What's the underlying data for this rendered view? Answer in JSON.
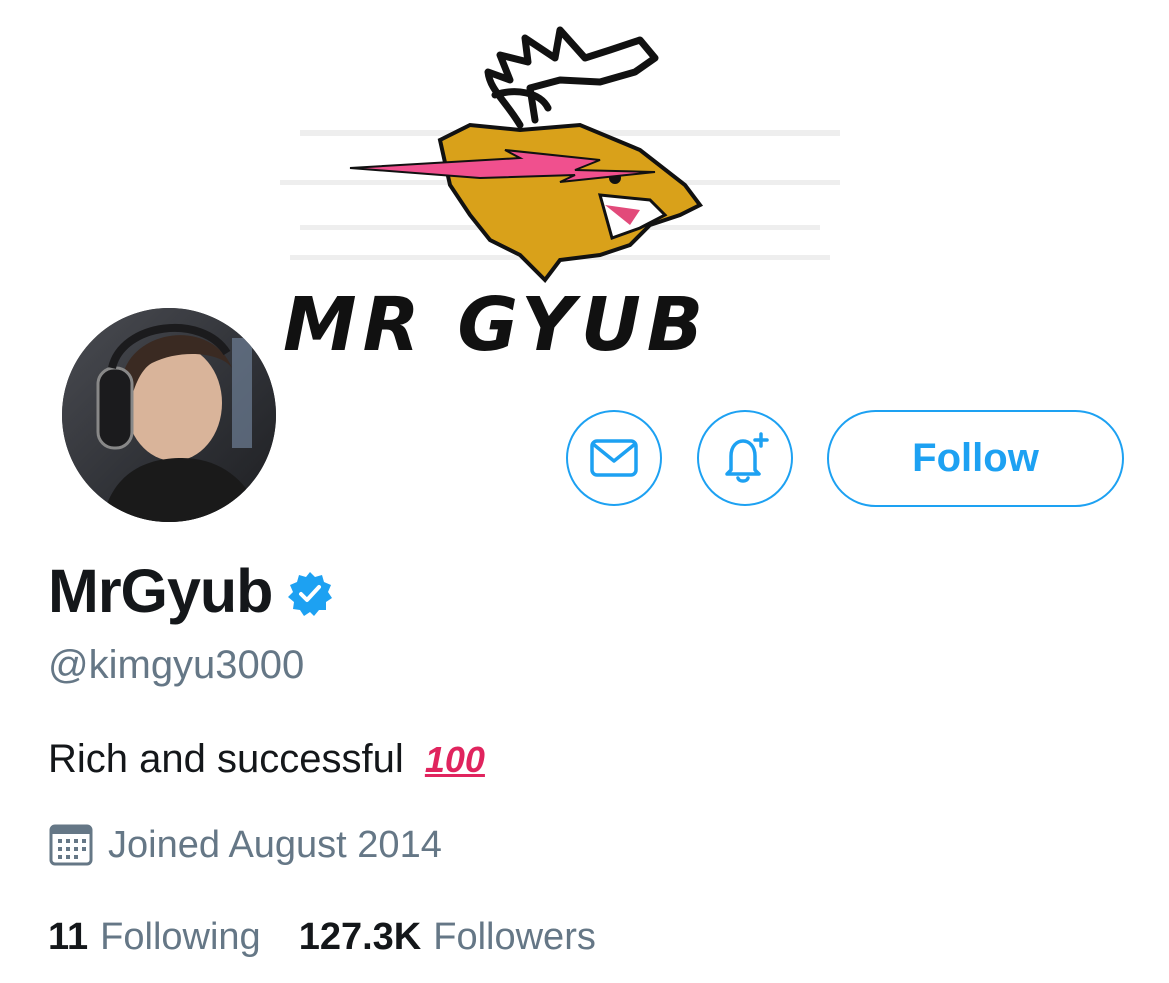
{
  "profile": {
    "display_name": "MrGyub",
    "handle": "@kimgyu3000",
    "bio": "Rich and successful",
    "bio_emoji": "100",
    "joined": "Joined August 2014",
    "verified": true
  },
  "banner": {
    "logo_text": "MR GYUB",
    "colors": {
      "tiger": "#d9a11a",
      "bolt": "#f0508e",
      "ink": "#111111"
    }
  },
  "actions": {
    "message_icon": "envelope-icon",
    "notify_icon": "bell-plus-icon",
    "follow_label": "Follow"
  },
  "stats": {
    "following_count": "11",
    "following_label": "Following",
    "followers_count": "127.3K",
    "followers_label": "Followers"
  },
  "colors": {
    "accent": "#1da1f2",
    "secondary_text": "#657786",
    "primary_text": "#14171a"
  }
}
